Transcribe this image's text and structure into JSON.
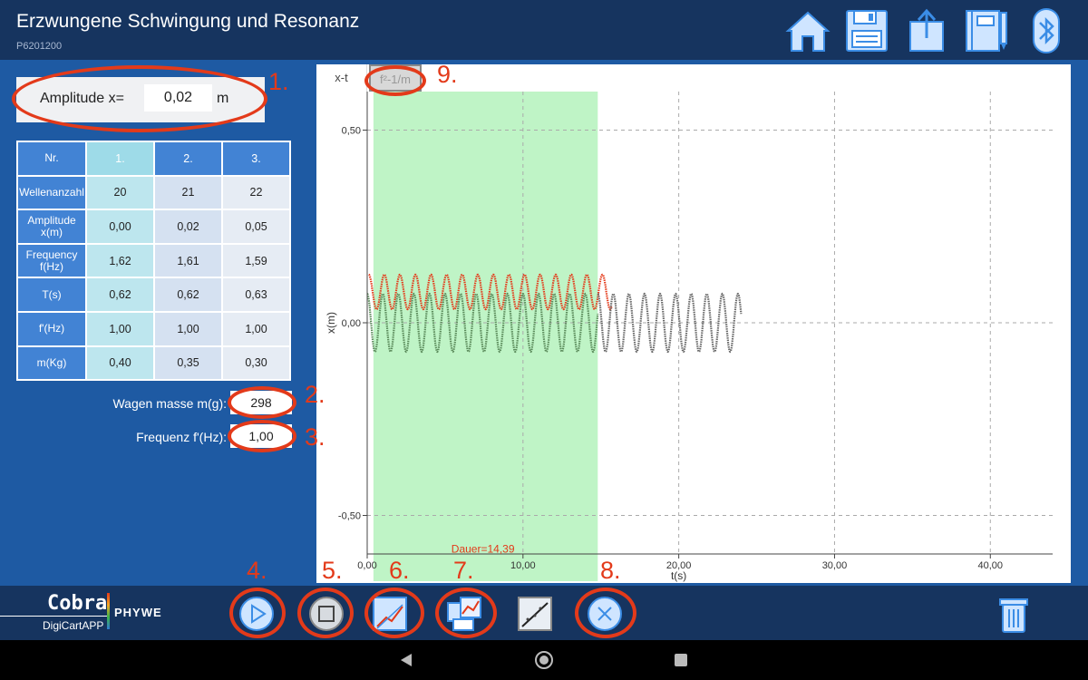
{
  "header": {
    "title": "Erzwungene Schwingung und Resonanz",
    "subtitle": "P6201200",
    "icons": [
      "home-icon",
      "save-icon",
      "export-icon",
      "notebook-icon",
      "bluetooth-icon"
    ]
  },
  "amplitude": {
    "label": "Amplitude  x=",
    "value": "0,02",
    "unit": "m"
  },
  "table": {
    "header_label": "Nr.",
    "columns": [
      "1.",
      "2.",
      "3."
    ],
    "rows": [
      {
        "label": "Wellenanzahl",
        "values": [
          "20",
          "21",
          "22"
        ]
      },
      {
        "label": "Amplitude x(m)",
        "values": [
          "0,00",
          "0,02",
          "0,05"
        ]
      },
      {
        "label": "Frequency f(Hz)",
        "values": [
          "1,62",
          "1,61",
          "1,59"
        ]
      },
      {
        "label": "T(s)",
        "values": [
          "0,62",
          "0,62",
          "0,63"
        ]
      },
      {
        "label": "f'(Hz)",
        "values": [
          "1,00",
          "1,00",
          "1,00"
        ]
      },
      {
        "label": "m(Kg)",
        "values": [
          "0,40",
          "0,35",
          "0,30"
        ]
      }
    ]
  },
  "fields": {
    "mass_label": "Wagen masse m(g):",
    "mass_value": "298",
    "freq_label": "Frequenz f'(Hz):",
    "freq_value": "1,00"
  },
  "annotations": [
    "1.",
    "2.",
    "3.",
    "4.",
    "5.",
    "6.",
    "7.",
    "8.",
    "9."
  ],
  "chart_tabs": [
    "x-t",
    "f²-1/m"
  ],
  "chart_data": {
    "type": "line",
    "xlabel": "t(s)",
    "ylabel": "x(m)",
    "xlim": [
      0,
      44
    ],
    "ylim": [
      -0.6,
      0.6
    ],
    "x_ticks": [
      "0,00",
      "10,00",
      "20,00",
      "30,00",
      "40,00"
    ],
    "y_ticks": [
      "0,50",
      "0,00",
      "-0,50"
    ],
    "highlight_range": [
      0.4,
      14.8
    ],
    "annotation": "Dauer=14,39",
    "series": [
      {
        "color": "#e33a1a",
        "t_start": 0.1,
        "t_end": 15.7,
        "frequency": 1.0,
        "amplitude": 0.045,
        "offset": 0.08
      },
      {
        "color": "#5a8a5a",
        "t_start": 0.0,
        "t_end": 14.8,
        "frequency": 1.0,
        "amplitude": 0.075,
        "offset": 0.0
      },
      {
        "color": "#666666",
        "t_start": 14.8,
        "t_end": 24.0,
        "frequency": 1.0,
        "amplitude": 0.075,
        "offset": 0.0
      }
    ]
  },
  "toolbar": {
    "logo_main": "Cobra",
    "logo_brand": "PHYWE",
    "logo_sub": "DigiCartAPP",
    "buttons": [
      "play-icon",
      "stop-icon",
      "chart-fit-icon",
      "chart-compare-icon",
      "line-fit-icon",
      "cancel-icon",
      "trash-icon"
    ]
  },
  "colors": {
    "header": "#16345f",
    "content": "#1e5aa3",
    "annotation": "#e33a1a",
    "highlight": "#bff4c6"
  }
}
